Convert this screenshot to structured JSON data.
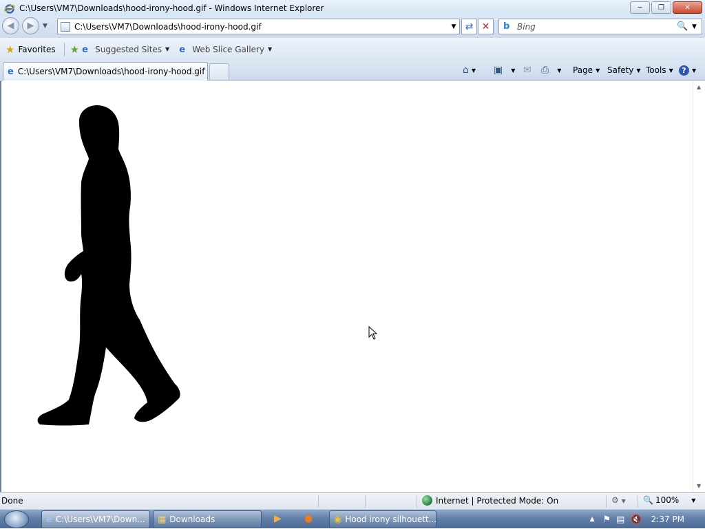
{
  "window": {
    "title": "C:\\Users\\VM7\\Downloads\\hood-irony-hood.gif - Windows Internet Explorer"
  },
  "navbar": {
    "address": "C:\\Users\\VM7\\Downloads\\hood-irony-hood.gif",
    "search_placeholder": "Bing"
  },
  "favorites": {
    "label": "Favorites",
    "items": [
      {
        "label": "Suggested Sites"
      },
      {
        "label": "Web Slice Gallery"
      }
    ]
  },
  "tabs": {
    "active_label": "C:\\Users\\VM7\\Downloads\\hood-irony-hood.gif"
  },
  "commandbar": {
    "page": "Page",
    "safety": "Safety",
    "tools": "Tools"
  },
  "statusbar": {
    "status": "Done",
    "zone": "Internet | Protected Mode: On",
    "zoom": "100%"
  },
  "taskbar": {
    "items": [
      {
        "label": "C:\\Users\\VM7\\Down..."
      },
      {
        "label": "Downloads"
      },
      {
        "label": "Hood irony silhouett..."
      }
    ],
    "clock": "2:37 PM"
  },
  "colors": {
    "taskbar": "#5f7da6",
    "close_button": "#c94a2d"
  }
}
